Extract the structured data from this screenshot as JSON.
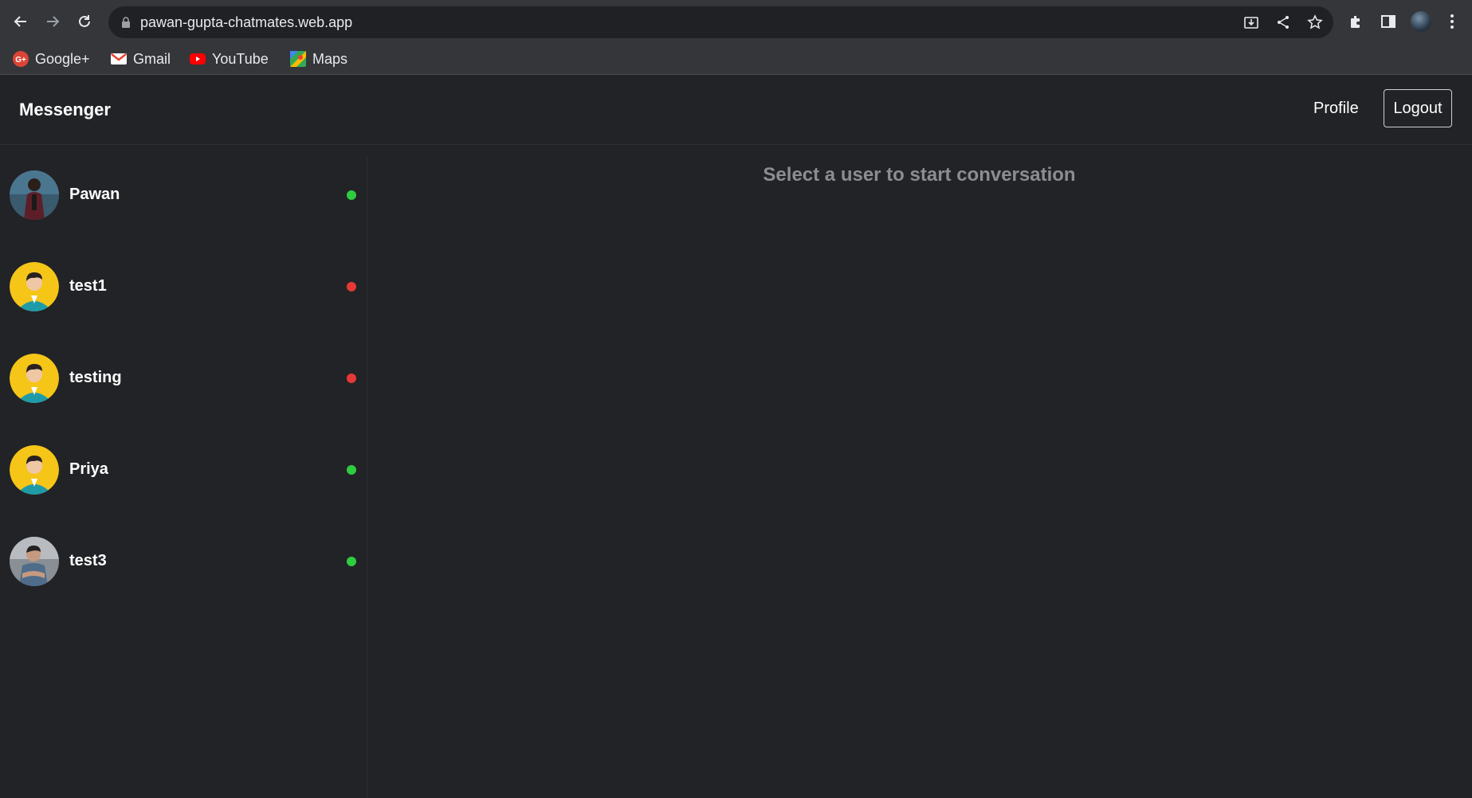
{
  "browser": {
    "url": "pawan-gupta-chatmates.web.app",
    "bookmarks": [
      {
        "label": "Google+",
        "icon": "google-plus-icon",
        "color": "#db4437"
      },
      {
        "label": "Gmail",
        "icon": "gmail-icon",
        "color": "#ea4335"
      },
      {
        "label": "YouTube",
        "icon": "youtube-icon",
        "color": "#ff0000"
      },
      {
        "label": "Maps",
        "icon": "maps-icon",
        "color": "#34a853"
      }
    ]
  },
  "app": {
    "brand": "Messenger",
    "profile_label": "Profile",
    "logout_label": "Logout"
  },
  "users": [
    {
      "name": "Pawan",
      "online": true,
      "avatar": "photo"
    },
    {
      "name": "test1",
      "online": false,
      "avatar": "default"
    },
    {
      "name": "testing",
      "online": false,
      "avatar": "default"
    },
    {
      "name": "Priya",
      "online": true,
      "avatar": "default"
    },
    {
      "name": "test3",
      "online": true,
      "avatar": "photo"
    }
  ],
  "main": {
    "placeholder": "Select a user to start conversation"
  },
  "colors": {
    "online": "#2ecc40",
    "offline": "#e53935",
    "avatar_default_bg": "#f5c518"
  }
}
